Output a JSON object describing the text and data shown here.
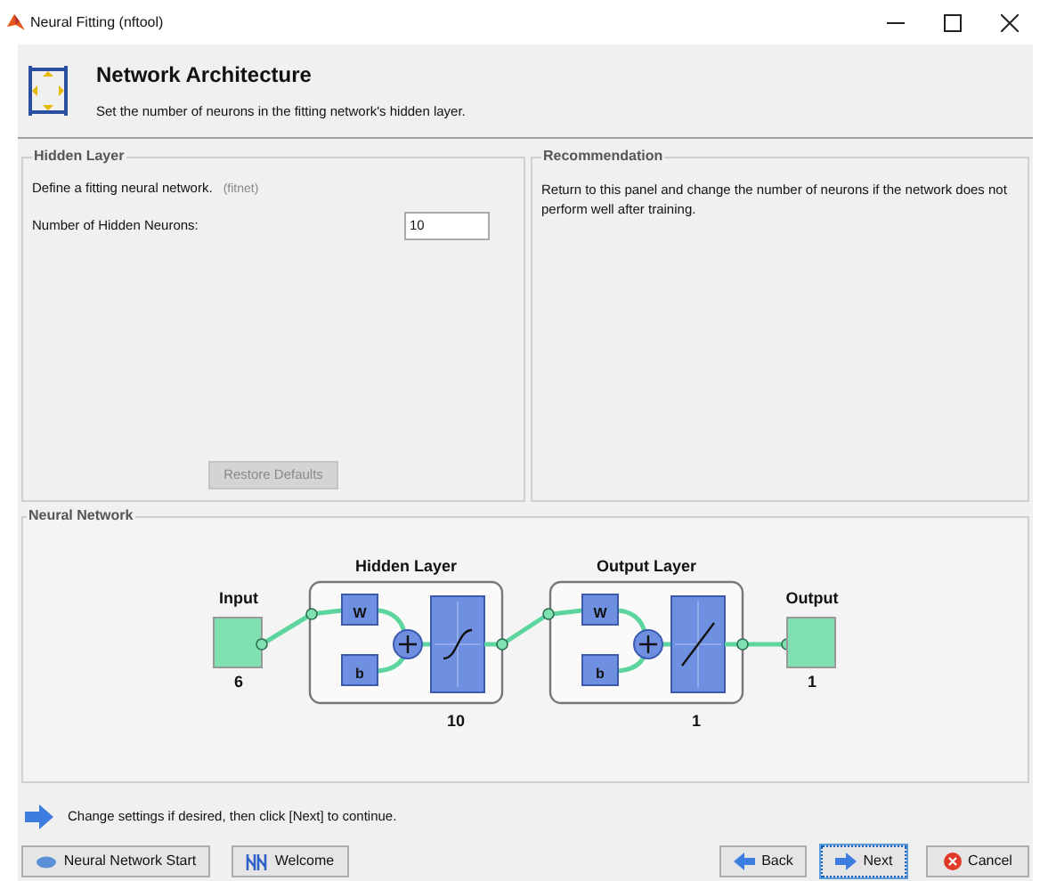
{
  "window": {
    "title": "Neural Fitting (nftool)"
  },
  "header": {
    "title": "Network Architecture",
    "subtitle": "Set the number of neurons in the fitting network's hidden layer."
  },
  "hidden_layer": {
    "title": "Hidden Layer",
    "description": "Define a fitting neural network.",
    "description_note": "(fitnet)",
    "neurons_label": "Number of Hidden Neurons:",
    "neurons_value": "10",
    "restore_button": {
      "label": "Restore Defaults",
      "disabled": true
    }
  },
  "recommendation": {
    "title": "Recommendation",
    "text": "Return to this panel and change the number of neurons if the network does not perform well after training."
  },
  "neural_network": {
    "title": "Neural Network",
    "input": {
      "label": "Input",
      "size": "6"
    },
    "layers": [
      {
        "title": "Hidden Layer",
        "weight": "W",
        "bias": "b",
        "size": "10",
        "kind": "sigmoid"
      },
      {
        "title": "Output Layer",
        "weight": "W",
        "bias": "b",
        "size": "1",
        "kind": "linear"
      }
    ],
    "output": {
      "label": "Output",
      "size": "1"
    }
  },
  "instruction": "Change settings  if desired, then click [Next] to continue.",
  "buttons": [
    {
      "label": "Neural Network Start",
      "kind": "start",
      "focused": false
    },
    {
      "label": "Welcome",
      "kind": "welcome",
      "focused": false
    },
    {
      "label": "Back",
      "kind": "back",
      "focused": false
    },
    {
      "label": "Next",
      "kind": "next",
      "focused": true
    },
    {
      "label": "Cancel",
      "kind": "cancel",
      "focused": false
    }
  ]
}
